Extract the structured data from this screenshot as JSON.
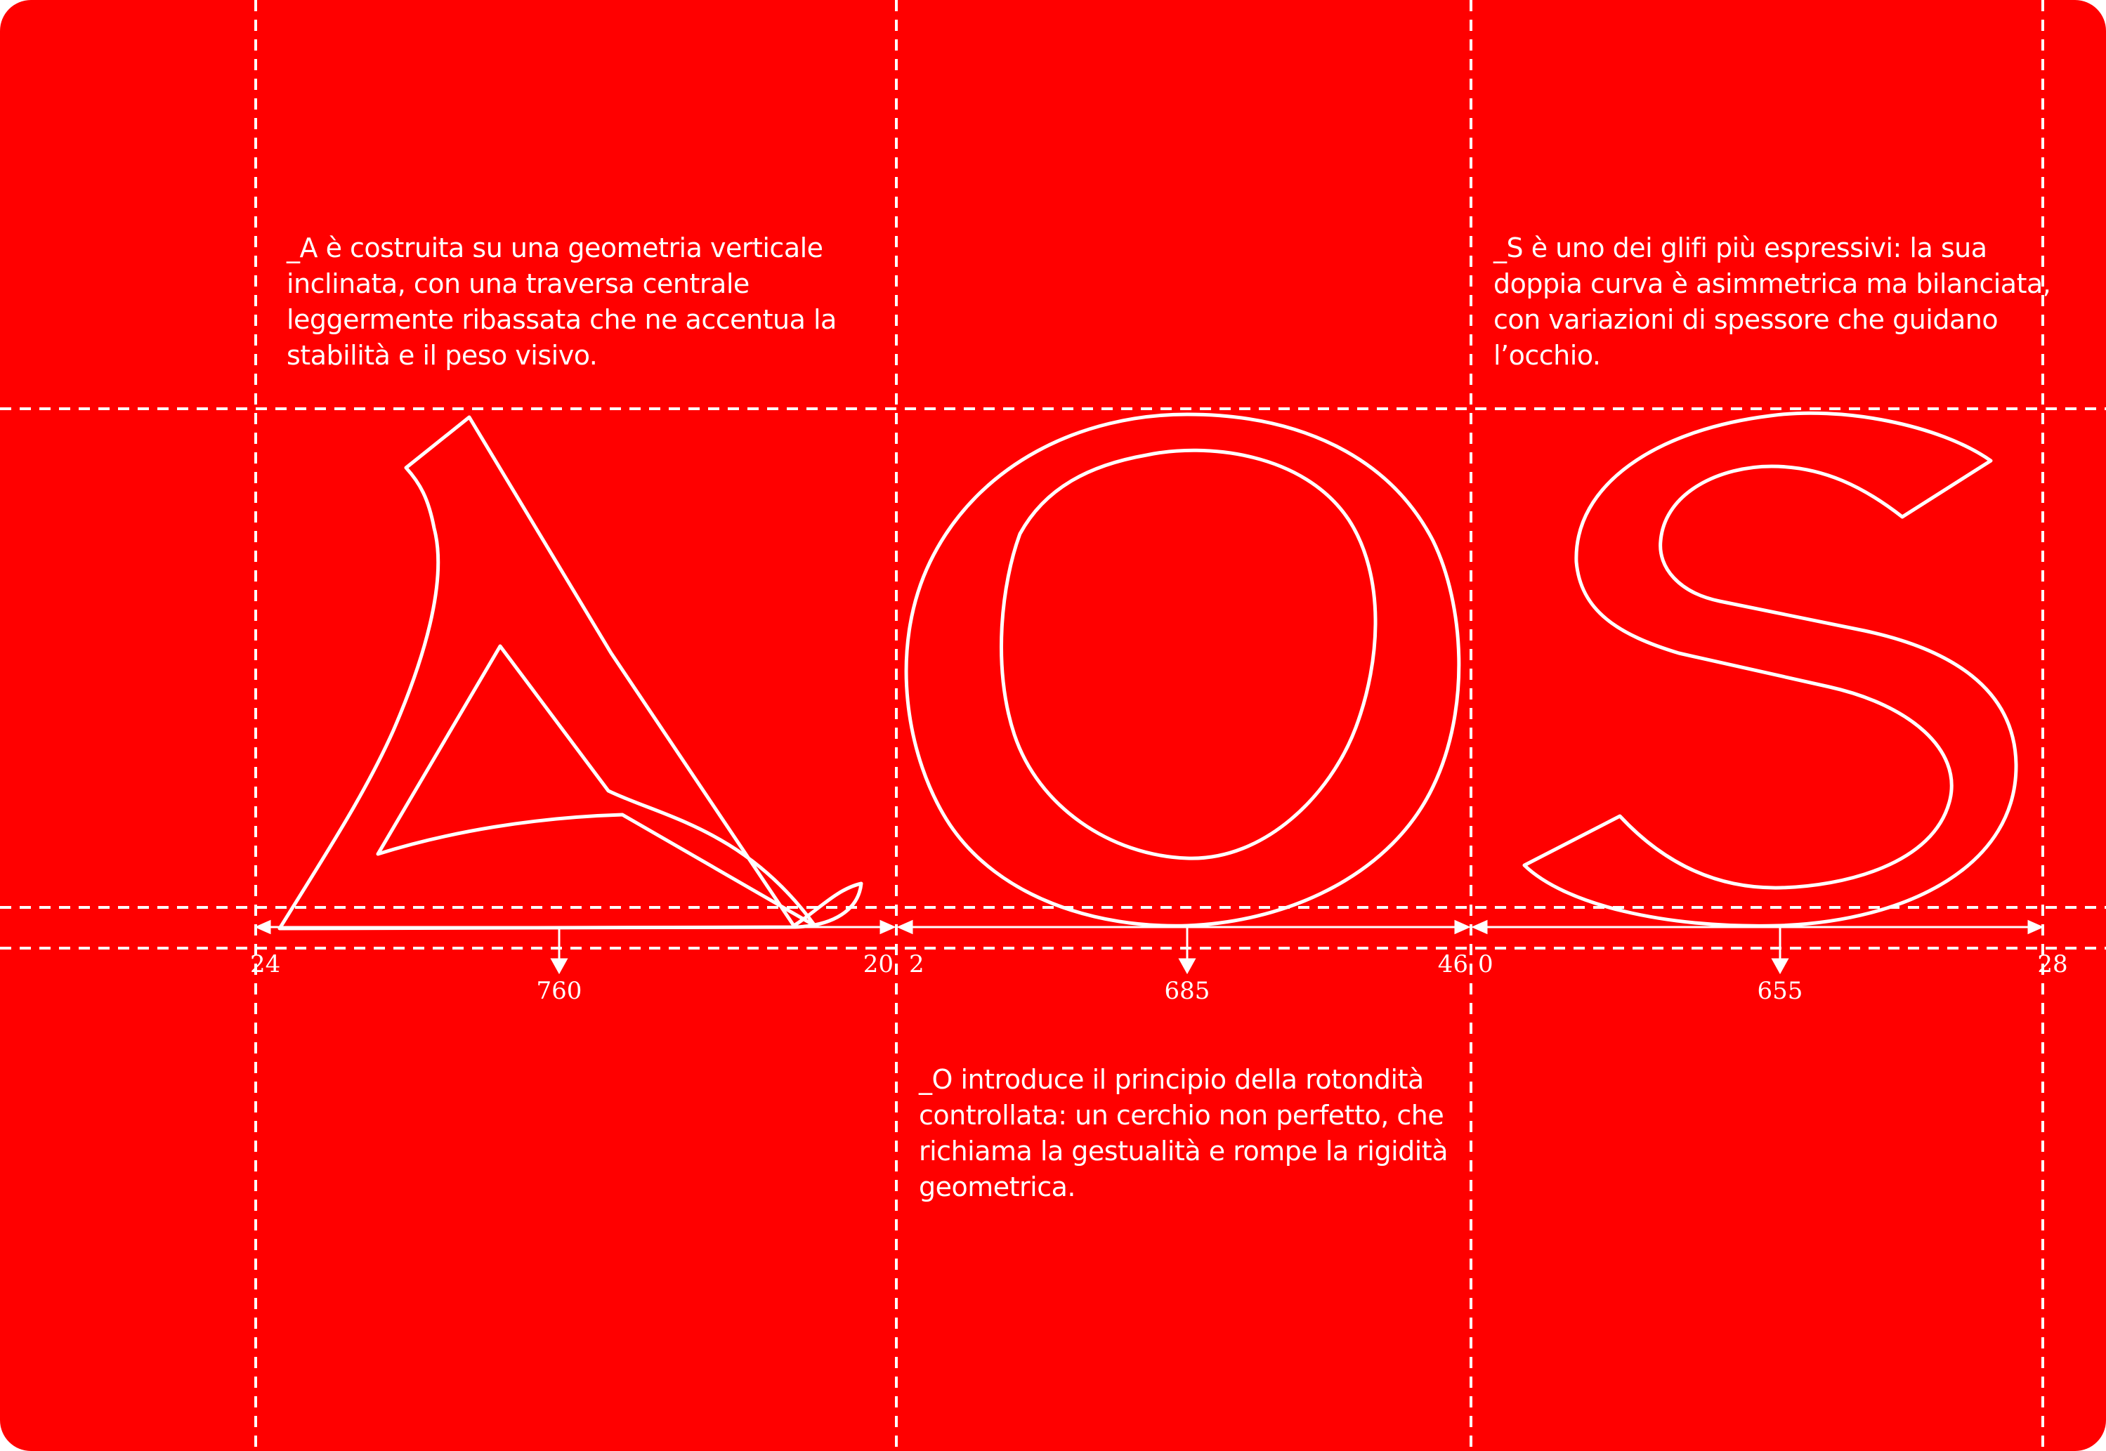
{
  "background_color": "#ff0000",
  "line_color": "#ffffff",
  "glyphs": [
    "A",
    "O",
    "S"
  ],
  "notes": {
    "a": "_A è costruita su una geometria verticale inclinata, con una traversa centrale leggermente ribassata che ne accentua la stabilità e il peso visivo.",
    "s": "_S è uno dei glifi più espressivi: la sua doppia curva è asimmetrica ma bilanciata, con variazioni di spessore che guidano l’occhio.",
    "o": "_O introduce il principio della rotondità controllata: un cerchio non perfetto, che richiama la gestualità e rompe la rigidità geometrica."
  },
  "metrics": {
    "a": {
      "left_bearing": "24",
      "advance_width": "760",
      "right_bearing": "20"
    },
    "o": {
      "left_bearing": "2",
      "advance_width": "685",
      "right_bearing": "46"
    },
    "s": {
      "left_bearing": "0",
      "advance_width": "655",
      "right_bearing": "28"
    }
  }
}
